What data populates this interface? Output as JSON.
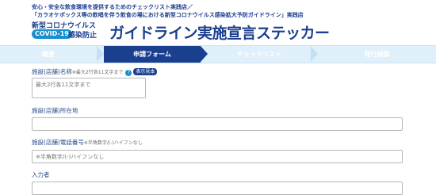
{
  "header": {
    "line1": "安心・安全な飲食環境を提供するためのチェックリスト実践店／",
    "line2": "「カラオケボックス等の飲唱を伴う飲食の場における新型コロナウイルス感染拡大予防ガイドライン」実践店",
    "sub1": "新型コロナウイルス",
    "badge": "COVID-19",
    "sub2": "感染防止",
    "title": "ガイドライン実施宣言ステッカー"
  },
  "steps": [
    {
      "label": "概要",
      "active": false
    },
    {
      "label": "申請フォーム",
      "active": true
    },
    {
      "label": "チェックリスト",
      "active": false
    },
    {
      "label": "発行画面",
      "active": false
    }
  ],
  "form": {
    "name_label": "施設(店舗)名称",
    "name_note": "※最大2行各11文字まで",
    "example_label": "表示見本",
    "q_icon": "?",
    "name_placeholder": "最大2行各11文字まで",
    "address_label": "施設(店舗)所在地",
    "address_placeholder": "",
    "phone_label": "施設(店舗)電話番号",
    "phone_note": "※半角数字/(-)ハイフンなし",
    "phone_placeholder": "※半角数字/(-)ハイフンなし",
    "entrant_label": "入力者",
    "entrant_placeholder": ""
  }
}
